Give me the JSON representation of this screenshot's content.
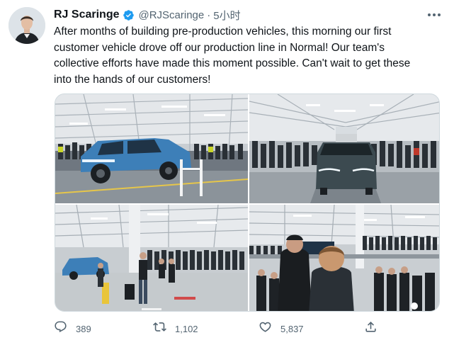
{
  "tweet": {
    "author_name": "RJ Scaringe",
    "handle": "@RJScaringe",
    "separator": "·",
    "time": "5小时",
    "text": "After months of building pre-production vehicles, this morning our first\ncustomer vehicle drove off our production line in Normal!  Our team's\ncollective efforts have made this moment possible. Can't wait to get these\ninto the hands of our customers!",
    "verified": true
  },
  "icons": {
    "verified": "verified-badge-icon",
    "more": "more-options-icon",
    "reply": "reply-icon",
    "retweet": "retweet-icon",
    "like": "like-icon",
    "share": "share-icon"
  },
  "metrics": {
    "replies": "389",
    "retweets": "1,102",
    "likes": "5,837"
  },
  "colors": {
    "accent": "#1d9bf0",
    "text": "#0f1419",
    "secondary": "#536471",
    "truck_blue": "#3d7fb8",
    "truck_green": "#3c4a50"
  }
}
